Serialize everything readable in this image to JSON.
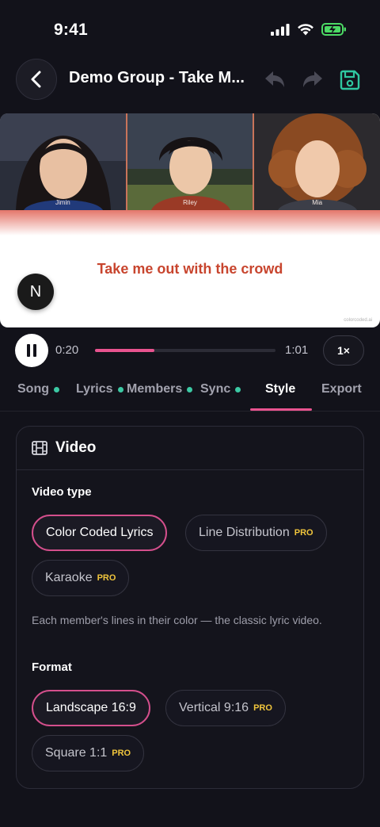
{
  "status": {
    "time": "9:41"
  },
  "nav": {
    "title": "Demo Group - Take M..."
  },
  "preview": {
    "members": [
      "Jimin",
      "Riley",
      "Mia"
    ],
    "lyric": "Take me out with the crowd",
    "badge": "N",
    "watermark": "colorcoded.ai"
  },
  "player": {
    "current_time": "0:20",
    "total_time": "1:01",
    "speed": "1×",
    "progress": 0.33
  },
  "tabs": [
    {
      "label": "Song",
      "done": true
    },
    {
      "label": "Lyrics",
      "done": true
    },
    {
      "label": "Members",
      "done": true
    },
    {
      "label": "Sync",
      "done": true
    },
    {
      "label": "Style",
      "active": true
    },
    {
      "label": "Export"
    }
  ],
  "card": {
    "title": "Video",
    "video_type_label": "Video type",
    "video_types": [
      {
        "label": "Color Coded Lyrics",
        "selected": true
      },
      {
        "label": "Line Distribution",
        "pro": "PRO"
      },
      {
        "label": "Karaoke",
        "pro": "PRO"
      }
    ],
    "description": "Each member's lines in their color — the classic lyric video.",
    "format_label": "Format",
    "formats": [
      {
        "label": "Landscape 16:9",
        "selected": true
      },
      {
        "label": "Vertical 9:16",
        "pro": "PRO"
      },
      {
        "label": "Square 1:1",
        "pro": "PRO"
      }
    ]
  },
  "colors": {
    "accent": "#e8538f",
    "pro": "#f0c53c",
    "sync_dot": "#3cc9a4",
    "lyric": "#c8452e"
  }
}
